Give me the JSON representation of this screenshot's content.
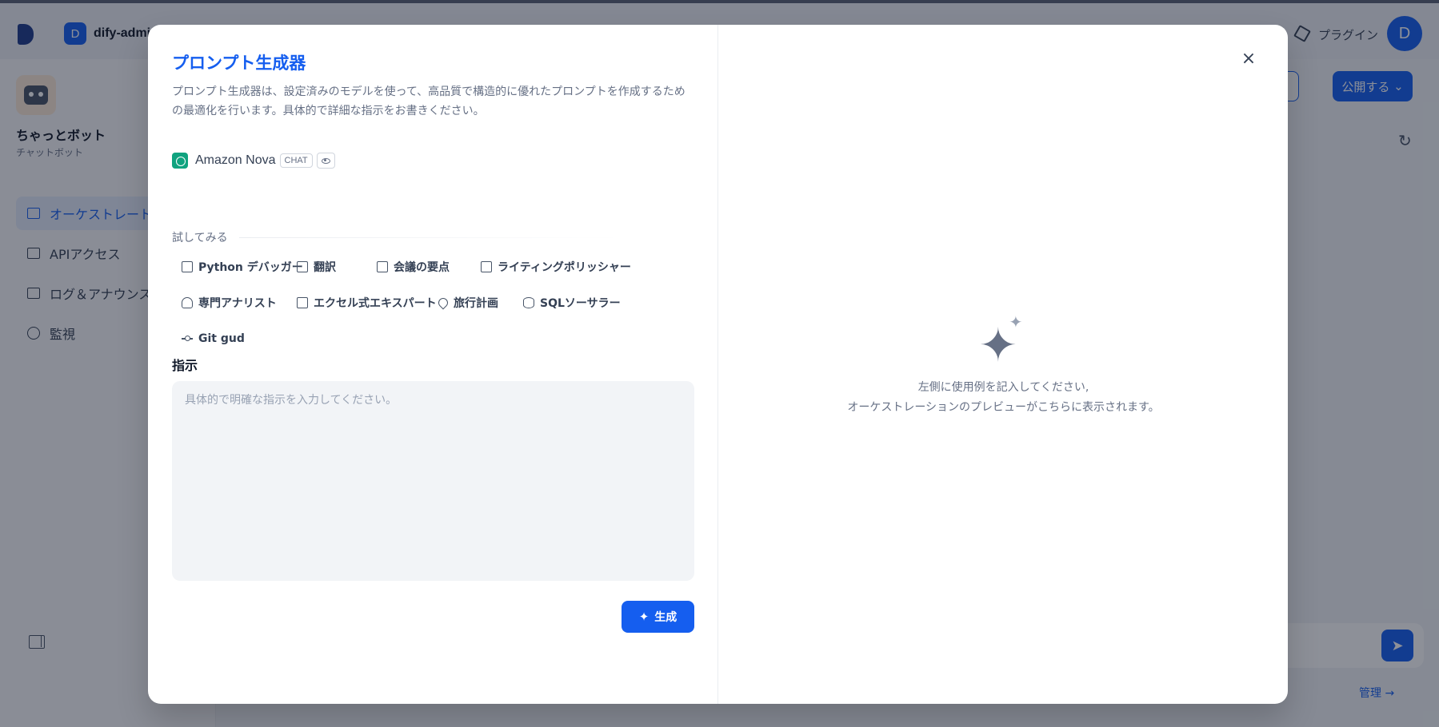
{
  "background": {
    "workspace_badge": "D",
    "workspace_name": "dify-admi",
    "plugin_label": "プラグイン",
    "user_avatar": "D",
    "app_name": "ちゃっとボット",
    "app_type": "チャットボット",
    "nav": [
      {
        "label": "オーケストレート",
        "icon": "layout-icon",
        "active": true
      },
      {
        "label": "APIアクセス",
        "icon": "terminal-icon",
        "active": false
      },
      {
        "label": "ログ＆アナウンス",
        "icon": "file-list-icon",
        "active": false
      },
      {
        "label": "監視",
        "icon": "dashboard-icon",
        "active": false
      }
    ],
    "publish_label": "公開する",
    "manage_label": "管理 →"
  },
  "modal": {
    "title": "プロンプト生成器",
    "description": "プロンプト生成器は、設定済みのモデルを使って、高品質で構造的に優れたプロンプトを作成するための最適化を行います。具体的で詳細な指示をお書きください。",
    "model": {
      "name": "Amazon Nova",
      "mode_tag": "CHAT",
      "icon": "openai-icon"
    },
    "try_label": "試してみる",
    "examples": [
      {
        "label": "Python デバッガー",
        "icon": "terminal-icon"
      },
      {
        "label": "翻訳",
        "icon": "translate-icon"
      },
      {
        "label": "会議の要点",
        "icon": "meeting-icon"
      },
      {
        "label": "ライティングポリッシャー",
        "icon": "article-icon"
      },
      {
        "label": "専門アナリスト",
        "icon": "user-icon"
      },
      {
        "label": "エクセル式エキスパート",
        "icon": "excel-icon"
      },
      {
        "label": "旅行計画",
        "icon": "map-pin-icon"
      },
      {
        "label": "SQLソーサラー",
        "icon": "database-icon"
      },
      {
        "label": "Git gud",
        "icon": "git-commit-icon"
      }
    ],
    "instruction_label": "指示",
    "instruction_placeholder": "具体的で明確な指示を入力してください。",
    "instruction_value": "",
    "generate_label": "生成",
    "empty_line1": "左側に使用例を記入してください,",
    "empty_line2": "オーケストレーションのプレビューがこちらに表示されます。"
  }
}
